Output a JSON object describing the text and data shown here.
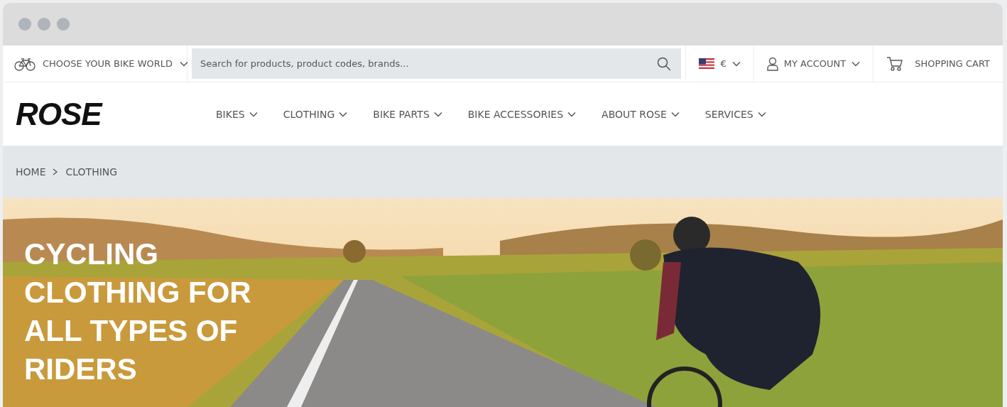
{
  "top_bar": {
    "bike_world": {
      "label": "CHOOSE YOUR BIKE WORLD"
    },
    "search": {
      "placeholder": "Search for products, product codes, brands..."
    },
    "currency": {
      "label": "€"
    },
    "account": {
      "label": "MY ACCOUNT"
    },
    "cart": {
      "label": "SHOPPING CART"
    }
  },
  "header": {
    "logo": "ROSE",
    "nav": [
      {
        "label": "BIKES"
      },
      {
        "label": "CLOTHING"
      },
      {
        "label": "BIKE PARTS"
      },
      {
        "label": "BIKE ACCESSORIES"
      },
      {
        "label": "ABOUT ROSE"
      },
      {
        "label": "SERVICES"
      }
    ]
  },
  "breadcrumb": [
    {
      "label": "HOME"
    },
    {
      "label": "CLOTHING"
    }
  ],
  "hero": {
    "kind": "picture",
    "title": "CYCLING CLOTHING FOR ALL TYPES OF RIDERS"
  }
}
